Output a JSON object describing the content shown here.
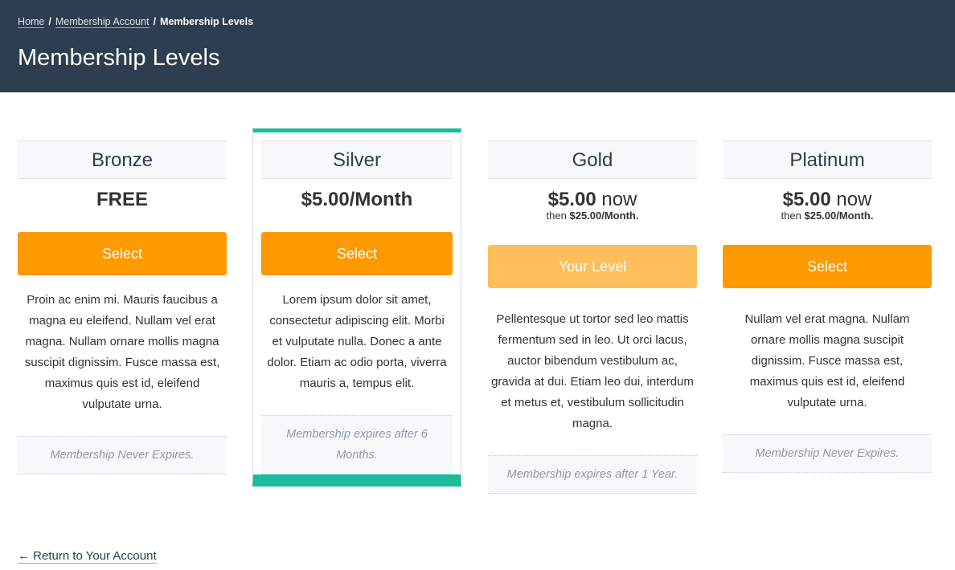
{
  "breadcrumb": {
    "home": "Home",
    "account": "Membership Account",
    "current": "Membership Levels",
    "separator": "/"
  },
  "page_title": "Membership Levels",
  "levels": [
    {
      "name": "Bronze",
      "price": "FREE",
      "button": "Select",
      "description": "Proin ac enim mi. Mauris faucibus a magna eu eleifend. Nullam vel erat magna. Nullam ornare mollis magna suscipit dignissim. Fusce massa est, maximus quis est id, eleifend vulputate urna.",
      "expiration": "Membership Never Expires."
    },
    {
      "name": "Silver",
      "price": "$5.00/Month",
      "button": "Select",
      "description": "Lorem ipsum dolor sit amet, consectetur adipiscing elit. Morbi et vulputate nulla. Donec a ante dolor. Etiam ac odio porta, viverra mauris a, tempus elit.",
      "expiration": "Membership expires after 6 Months."
    },
    {
      "name": "Gold",
      "price_main": "$5.00",
      "price_now": "now",
      "price_then_prefix": "then",
      "price_then_amount": "$25.00/Month.",
      "button": "Your Level",
      "description": "Pellentesque ut tortor sed leo mattis fermentum sed in leo. Ut orci lacus, auctor bibendum vestibulum ac, gravida at dui. Etiam leo dui, interdum et metus et, vestibulum sollicitudin magna.",
      "expiration": "Membership expires after 1 Year."
    },
    {
      "name": "Platinum",
      "price_main": "$5.00",
      "price_now": "now",
      "price_then_prefix": "then",
      "price_then_amount": "$25.00/Month.",
      "button": "Select",
      "description": "Nullam vel erat magna. Nullam ornare mollis magna suscipit dignissim. Fusce massa est, maximus quis est id, eleifend vulputate urna.",
      "expiration": "Membership Never Expires."
    }
  ],
  "back_link": "← Return to Your Account",
  "colors": {
    "header_bg": "#2c3e50",
    "button": "#ff9900",
    "button_current": "#ffbe5c",
    "featured_accent": "#1abc9c"
  }
}
